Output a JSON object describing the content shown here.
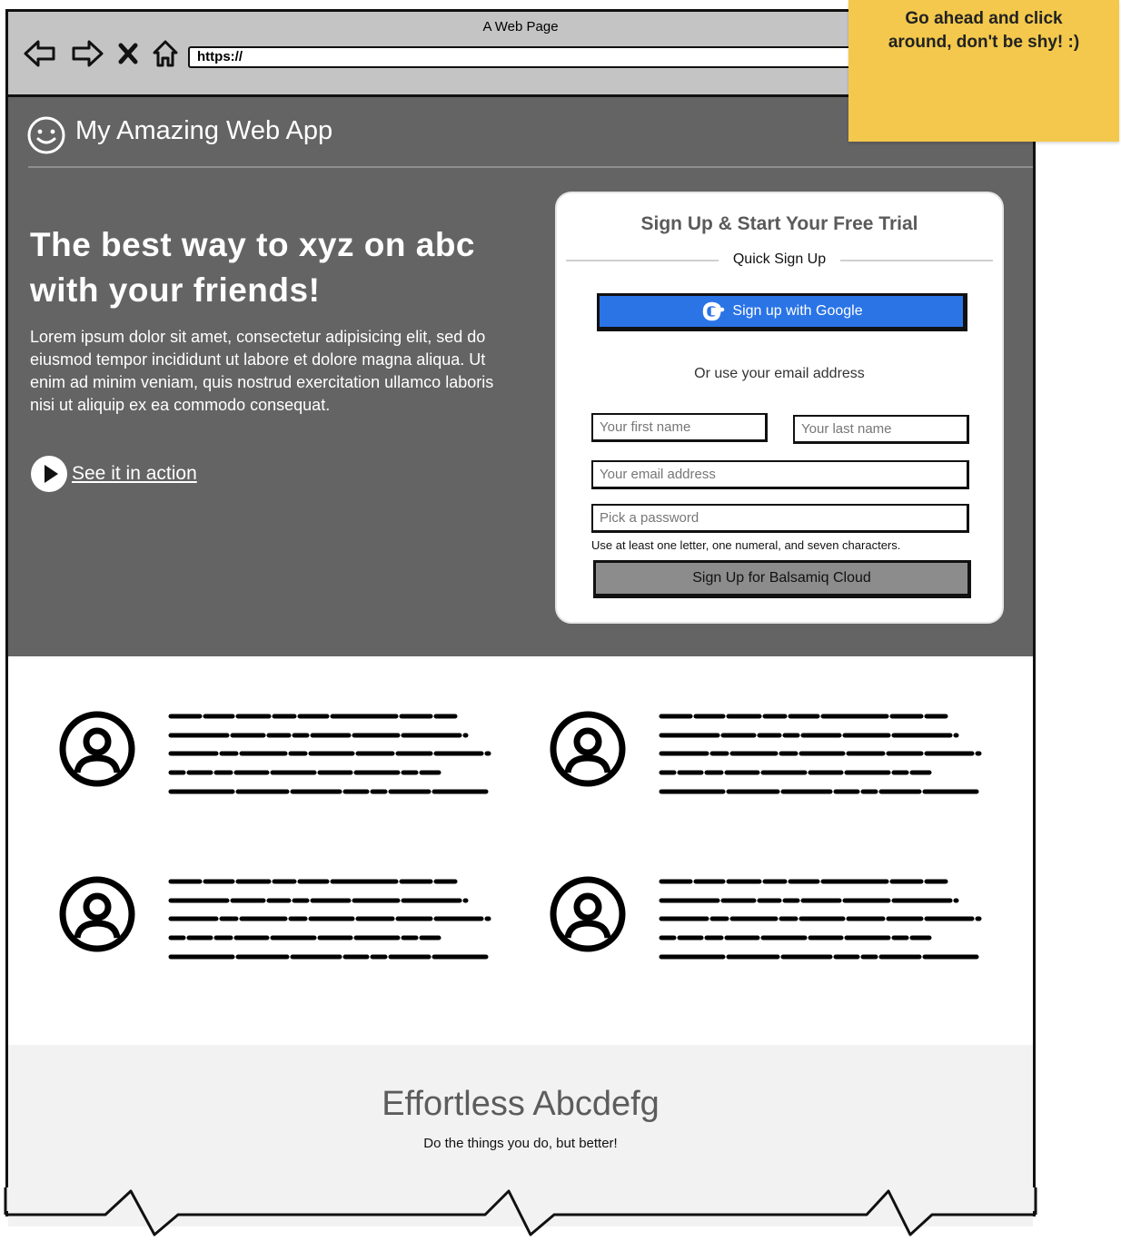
{
  "browser": {
    "window_title": "A Web Page",
    "url": "https://",
    "nav_icons": [
      "back-arrow-icon",
      "forward-arrow-icon",
      "stop-icon",
      "home-icon"
    ]
  },
  "app": {
    "name": "My Amazing Web App",
    "logo_icon": "smiley-icon"
  },
  "hero": {
    "title": "The best way to xyz on abc with your friends!",
    "body": "Lorem ipsum dolor sit amet, consectetur adipisicing elit, sed do eiusmod tempor incididunt ut labore et dolore magna aliqua. Ut enim ad minim veniam, quis nostrud exercitation ullamco laboris nisi ut aliquip ex ea commodo consequat.",
    "cta_label": "See it in action"
  },
  "signup": {
    "title": "Sign Up & Start Your Free Trial",
    "quick_label": "Quick Sign Up",
    "google_label": "Sign up with Google",
    "or_text": "Or use your email address",
    "first_name_placeholder": "Your first name",
    "last_name_placeholder": "Your last name",
    "email_placeholder": "Your email address",
    "password_placeholder": "Pick a password",
    "password_hint": "Use at least one letter, one numeral, and seven characters.",
    "submit_label": "Sign Up for Balsamiq Cloud"
  },
  "features": [
    {
      "icon": "user-avatar-icon"
    },
    {
      "icon": "user-avatar-icon"
    },
    {
      "icon": "user-avatar-icon"
    },
    {
      "icon": "user-avatar-icon"
    }
  ],
  "footer": {
    "title": "Effortless Abcdefg",
    "subtitle": "Do the things you do, but better!"
  },
  "sticky_note": {
    "text": "Go ahead and click around, don't be shy! :)"
  },
  "colors": {
    "header_bg": "#646464",
    "chrome_bg": "#c4c4c4",
    "google_blue": "#2a74e6",
    "submit_gray": "#8c8c8c",
    "sticky_yellow": "#f3c84c",
    "footer_bg": "#f2f2f2"
  }
}
